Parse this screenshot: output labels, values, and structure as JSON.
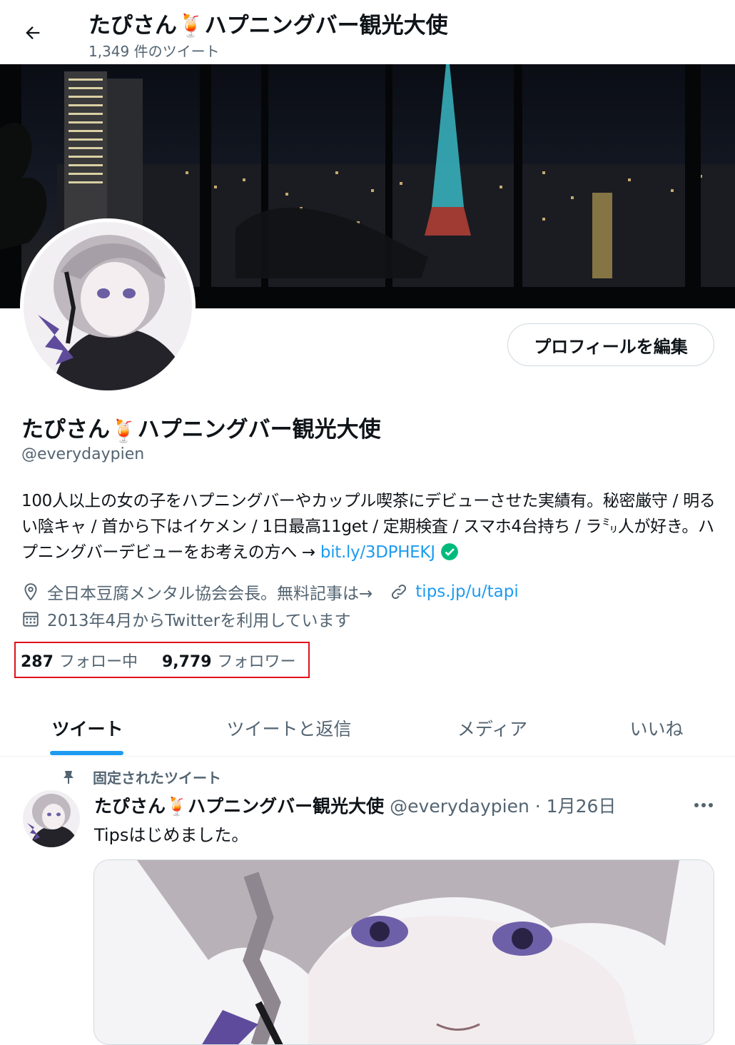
{
  "header": {
    "title": "たぴさん🍹ハプニングバー観光大使",
    "tweet_count": "1,349 件のツイート"
  },
  "profile": {
    "name_text": "たぴさん",
    "name_emoji": "🍹",
    "name_suffix": "ハプニングバー観光大使",
    "handle": "@everydaypien",
    "edit_button": "プロフィールを編集",
    "bio_line1": "100人以上の女の子をハプニングバーやカップル喫茶にデビューさせた実績有。秘密厳守 / 明るい陰キャ / 首から下はイケメン / 1日最高11get / 定期検査 / スマホ4台持ち / ラ㍉人が好き。ハプニングバーデビューをお考えの方へ → ",
    "bio_link": "bit.ly/3DPHEKJ",
    "location": "全日本豆腐メンタル協会会長。無料記事は→",
    "website": "tips.jp/u/tapi",
    "joined": "2013年4月からTwitterを利用しています",
    "following_count": "287",
    "following_label": "フォロー中",
    "followers_count": "9,779",
    "followers_label": "フォロワー"
  },
  "tabs": [
    {
      "label": "ツイート",
      "active": true
    },
    {
      "label": "ツイートと返信",
      "active": false
    },
    {
      "label": "メディア",
      "active": false
    },
    {
      "label": "いいね",
      "active": false
    }
  ],
  "pinned_tweet": {
    "pinned_label": "固定されたツイート",
    "author_name": "たぴさん",
    "author_suffix": "ハプニングバー観光大使",
    "author_handle": "@everydaypien · 1月26日",
    "text": "Tipsはじめました。"
  },
  "colors": {
    "accent": "#1d9bf0",
    "highlight_border": "#e0111a",
    "verified": "#00ba7c"
  },
  "icons": {
    "back": "arrow-left-icon",
    "location": "location-pin-icon",
    "link": "link-icon",
    "calendar": "calendar-icon",
    "pin": "pin-icon",
    "more": "more-dots-icon",
    "verified": "verified-check-icon"
  }
}
